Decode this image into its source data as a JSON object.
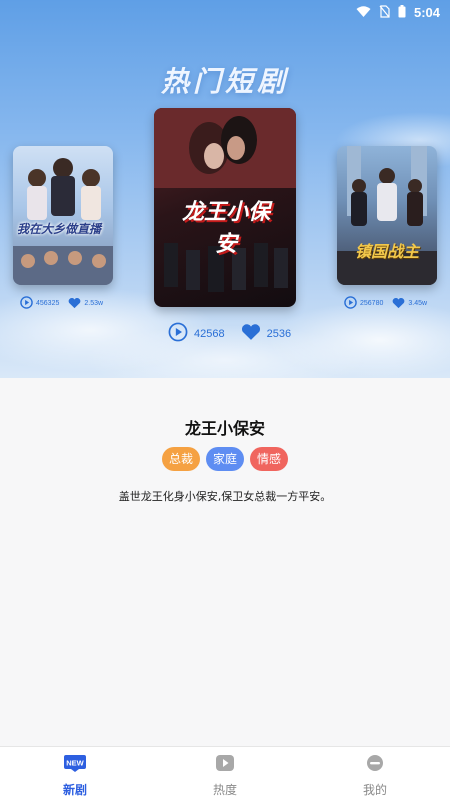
{
  "status": {
    "time": "5:04"
  },
  "hero": {
    "title": "热门短剧",
    "left_card": {
      "poster_text": "我在大乡做直播",
      "plays": "456325",
      "likes": "2.53w"
    },
    "center_card": {
      "poster_text": "龙王小保安",
      "plays": "42568",
      "likes": "2536"
    },
    "right_card": {
      "poster_text": "镇国战主",
      "plays": "256780",
      "likes": "3.45w"
    }
  },
  "detail": {
    "title": "龙王小保安",
    "tags": [
      {
        "label": "总裁",
        "color": "#f5a142"
      },
      {
        "label": "家庭",
        "color": "#5e8df2"
      },
      {
        "label": "情感",
        "color": "#f0655e"
      }
    ],
    "description": "盖世龙王化身小保安,保卫女总裁一方平安。"
  },
  "nav": {
    "items": [
      {
        "label": "新剧",
        "icon": "new-icon",
        "active": true
      },
      {
        "label": "热度",
        "icon": "play-square-icon",
        "active": false
      },
      {
        "label": "我的",
        "icon": "profile-icon",
        "active": false
      }
    ]
  },
  "colors": {
    "accent": "#2d5fe0",
    "stat_blue": "#2a6fd6"
  }
}
